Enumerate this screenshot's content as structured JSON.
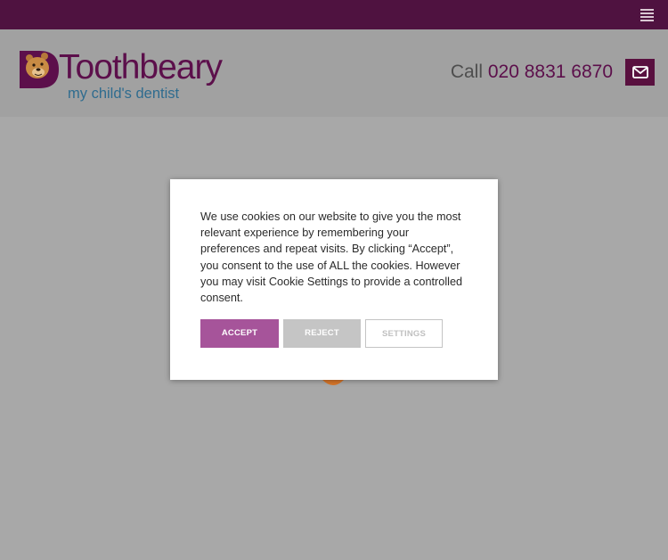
{
  "header": {
    "logo_word": "Toothbeary",
    "logo_tagline": "my child's dentist",
    "call_label": "Call",
    "phone": "020 8831 6870"
  },
  "icons": {
    "menu": "hamburger-menu-icon",
    "mail": "envelope-icon",
    "logo": "bear-tooth-logo-icon",
    "loader": "loading-spinner"
  },
  "cookie_banner": {
    "message": "We use cookies on our website to give you the most relevant experience by remembering your preferences and repeat visits. By clicking “Accept”, you consent to the use of ALL the cookies. However you may visit Cookie Settings to provide a controlled consent.",
    "accept_label": "ACCEPT",
    "reject_label": "REJECT",
    "settings_label": "SETTINGS"
  },
  "colors": {
    "brand_purple": "#5c0f4b",
    "top_bar": "#4f1240",
    "accept": "#a6549a",
    "reject": "#c5c5c5",
    "tagline_blue": "#2f6c8f",
    "loader_orange": "#d7762a"
  }
}
